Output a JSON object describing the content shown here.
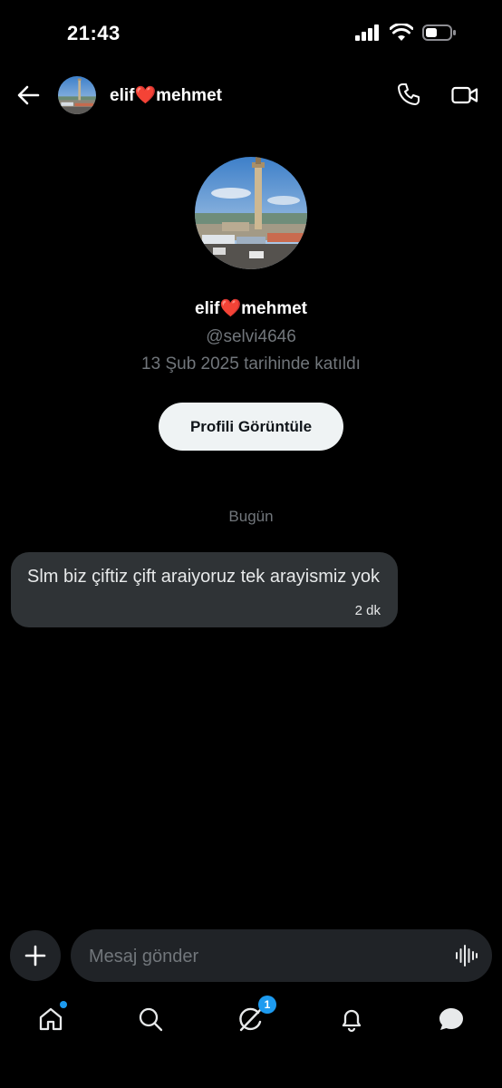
{
  "status_bar": {
    "time": "21:43"
  },
  "header": {
    "title": "elif❤️mehmet"
  },
  "profile": {
    "name": "elif❤️mehmet",
    "handle": "@selvi4646",
    "joined": "13 Şub 2025 tarihinde katıldı",
    "view_profile_label": "Profili Görüntüle"
  },
  "conversation": {
    "day_separator": "Bugün",
    "messages": [
      {
        "text": "Slm biz çiftiz çift araiyoruz tek arayismiz yok",
        "time": "2 dk"
      }
    ]
  },
  "composer": {
    "placeholder": "Mesaj gönder"
  },
  "tab_bar": {
    "items": [
      "home-icon",
      "search-icon",
      "grok-icon",
      "notifications-icon",
      "messages-icon"
    ],
    "grok_badge": "1"
  },
  "colors": {
    "accent": "#1d9bf0",
    "bubble": "#2f3336",
    "muted": "#71767b",
    "background": "#000000"
  }
}
